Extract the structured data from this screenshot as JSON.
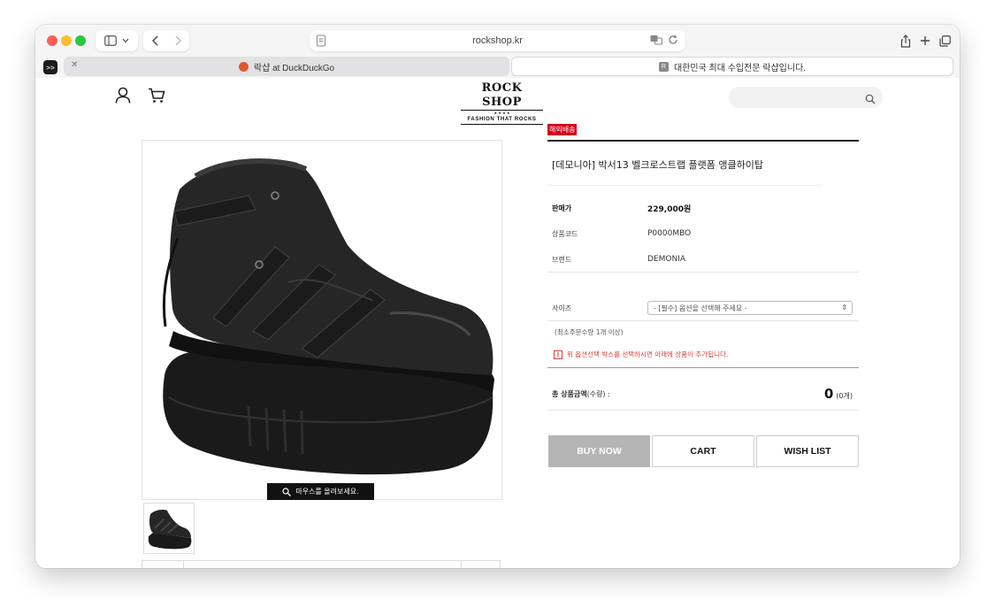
{
  "browser": {
    "address": "rockshop.kr",
    "tabs": [
      {
        "label": "락샵 at DuckDuckGo",
        "active": false
      },
      {
        "label": "대한민국 최대 수입전문 락샵입니다.",
        "active": true
      }
    ],
    "tab_favicon_letter": "R"
  },
  "header": {
    "logo_top": "ROCK SHOP",
    "logo_stars": "★ ★ ★ ★",
    "logo_sub": "FASHION THAT ROCKS",
    "search_placeholder": ""
  },
  "gallery": {
    "zoom_hint": "마우스를 올려보세요."
  },
  "product": {
    "badge": "해외배송",
    "title": "[데모니아] 박서13 벨크로스트랩 플랫폼 앵클하이탑",
    "price_label": "판매가",
    "price": "229,000원",
    "code_label": "상품코드",
    "code": "P0000MBO",
    "brand_label": "브랜드",
    "brand": "DEMONIA",
    "size_label": "사이즈",
    "size_select": "- [필수] 옵션을 선택해 주세요 -",
    "min_qty": "(최소주문수량 1개 이상)",
    "notice": "위 옵션선택 박스를 선택하시면 아래에 상품이 추가됩니다.",
    "notice_mark": "!",
    "total_label": "총 상품금액",
    "total_label_qty": "(수량) :",
    "total_value": "0",
    "total_count": "(0개)"
  },
  "actions": {
    "buy_now": "BUY NOW",
    "cart": "CART",
    "wish_list": "WISH LIST"
  },
  "colors": {
    "badge": "#d6001c",
    "buy_now_bg": "#b5b5b5",
    "notice": "#d43f3a"
  }
}
